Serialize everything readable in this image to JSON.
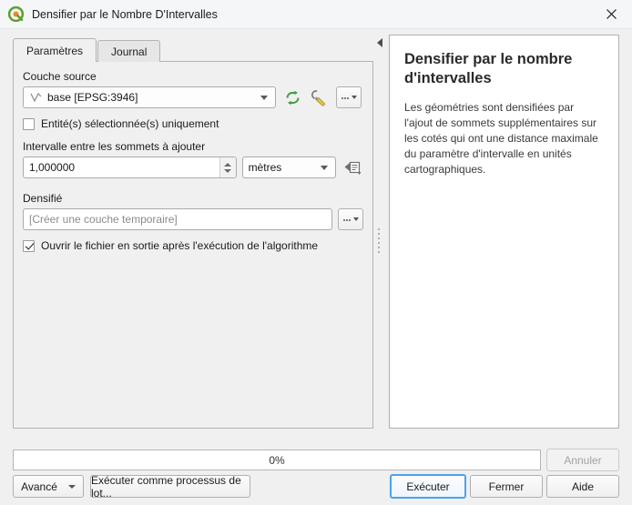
{
  "window": {
    "title": "Densifier par le Nombre D'Intervalles",
    "logo_icon": "qgis-logo-icon",
    "close_icon": "close-icon"
  },
  "tabs": [
    {
      "label": "Paramètres",
      "name": "tab-parametres",
      "active": true
    },
    {
      "label": "Journal",
      "name": "tab-journal",
      "active": false
    }
  ],
  "parameters": {
    "source_layer": {
      "label": "Couche source",
      "value": "base [EPSG:3946]",
      "geometry_icon": "line-vector-icon",
      "dropdown_icon": "chevron-down-icon",
      "iterate_icon": "iterate-features-icon",
      "advanced_icon": "wrench-icon",
      "browse_label": "..."
    },
    "selected_only": {
      "label": "Entité(s) sélectionnée(s) uniquement",
      "checked": false
    },
    "interval": {
      "label": "Intervalle entre les sommets à ajouter",
      "value": "1,000000",
      "units_value": "mètres",
      "data_defined_icon": "data-defined-override-icon",
      "spinner_up_icon": "spinner-up-icon",
      "spinner_down_icon": "spinner-down-icon"
    },
    "output": {
      "label": "Densifié",
      "placeholder": "[Créer une couche temporaire]",
      "value": "",
      "browse_label": "..."
    },
    "open_output": {
      "label": "Ouvrir le fichier en sortie après l'exécution de l'algorithme",
      "checked": true
    }
  },
  "panel": {
    "collapse_icon": "collapse-left-icon",
    "splitter_icon": "splitter-handle-icon"
  },
  "help": {
    "title": "Densifier par le nombre d'intervalles",
    "body": "Les géométries sont densifiées par l'ajout de sommets supplémentaires sur les cotés qui ont une distance maximale du paramètre d'intervalle en unités cartographiques."
  },
  "footer": {
    "progress_text": "0%",
    "progress_percent": 0,
    "cancel_label": "Annuler",
    "advanced_label": "Avancé",
    "batch_label": "Exécuter comme processus de lot...",
    "run_label": "Exécuter",
    "close_label": "Fermer",
    "help_label": "Aide"
  },
  "colors": {
    "window_bg": "#f0f0f0",
    "titlebar_bg": "#f4f6f8",
    "accent_focus": "#4da3e8",
    "qgis_green": "#5ea02f",
    "qgis_orange": "#e98b2a",
    "iterate_green": "#3c9f3c",
    "wrench_yellow": "#e8c84a"
  }
}
